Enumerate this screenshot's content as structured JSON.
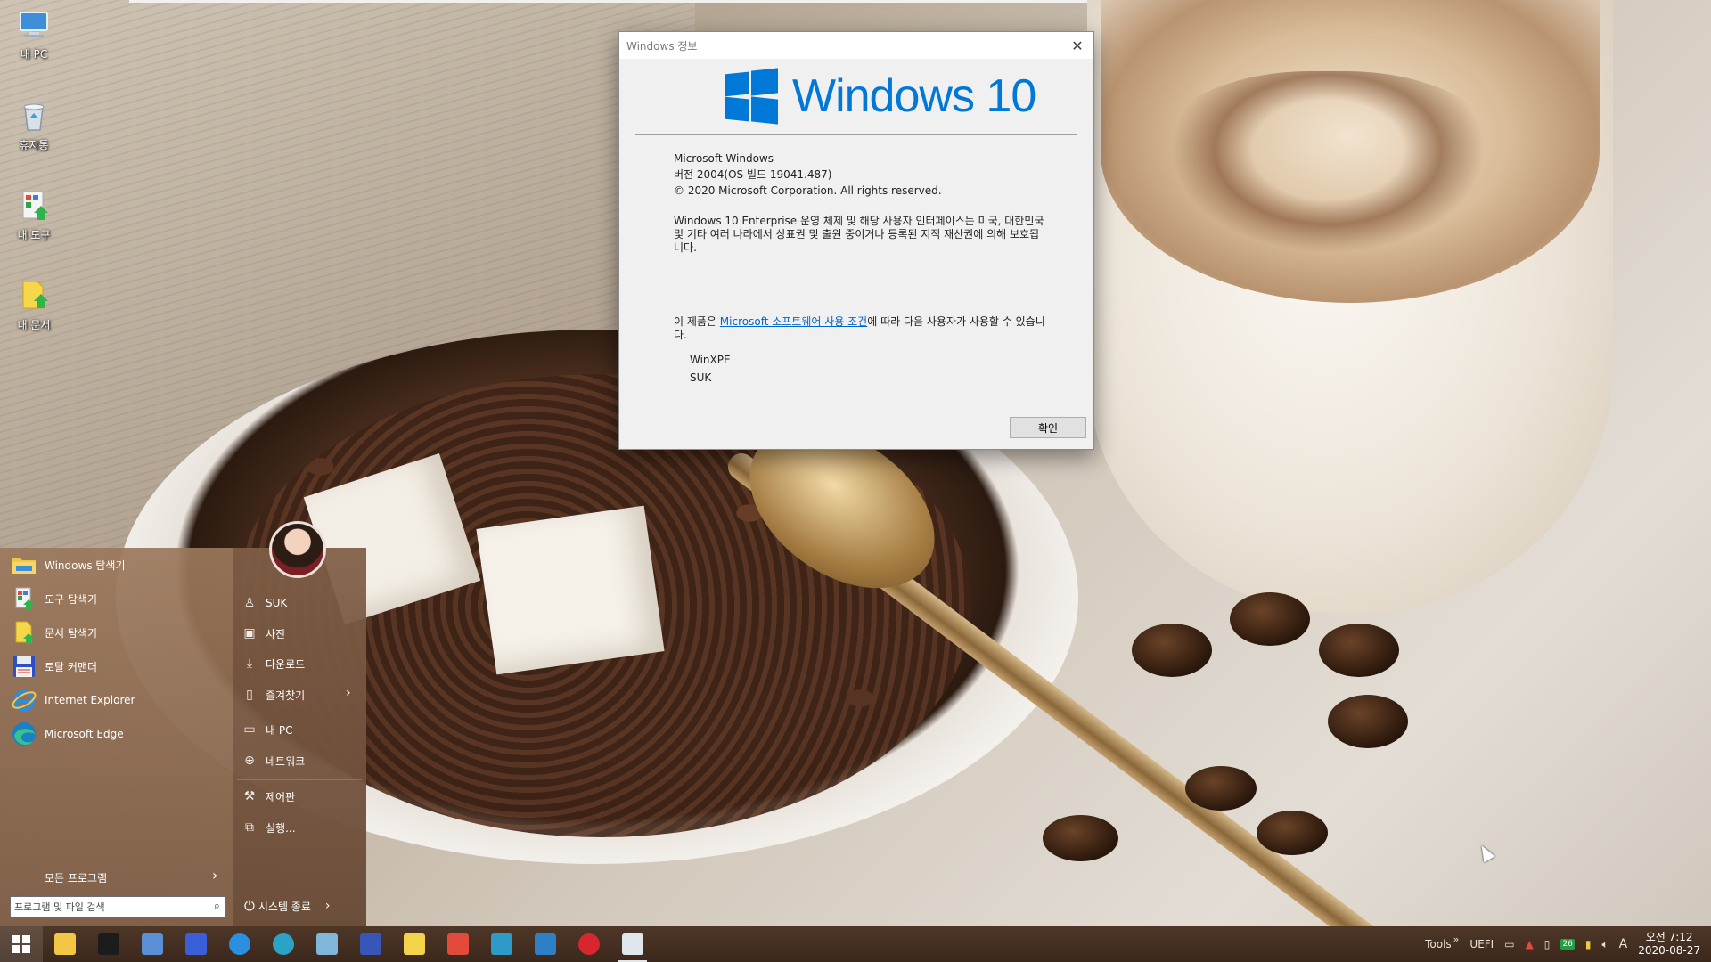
{
  "desktop": {
    "icons": [
      {
        "label": "내 PC",
        "icon": "computer-icon"
      },
      {
        "label": "휴지통",
        "icon": "recycle-bin-icon"
      },
      {
        "label": "내 도구",
        "icon": "tools-shortcut-icon"
      },
      {
        "label": "내 문서",
        "icon": "documents-shortcut-icon"
      }
    ]
  },
  "dialog": {
    "title": "Windows 정보",
    "brand": "Windows 10",
    "product": "Microsoft Windows",
    "version": "버전 2004(OS 빌드 19041.487)",
    "copyright": "© 2020 Microsoft Corporation. All rights reserved.",
    "legal": "Windows 10 Enterprise 운영 체제 및 해당 사용자 인터페이스는 미국, 대한민국 및 기타 여러 나라에서 상표권 및 출원 중이거나 등록된 지적 재산권에 의해 보호됩니다.",
    "license_prefix": "이 제품은 ",
    "license_link": "Microsoft 소프트웨어 사용 조건",
    "license_suffix": "에 따라 다음 사용자가 사용할 수 있습니다.",
    "users": [
      "WinXPE",
      "SUK"
    ],
    "ok_label": "확인"
  },
  "start_menu": {
    "programs": [
      {
        "label": "Windows 탐색기",
        "icon": "folder-icon"
      },
      {
        "label": "도구 탐색기",
        "icon": "tools-icon"
      },
      {
        "label": "문서 탐색기",
        "icon": "document-icon"
      },
      {
        "label": "토탈 커맨더",
        "icon": "floppy-disk-icon"
      },
      {
        "label": "Internet Explorer",
        "icon": "internet-explorer-icon"
      },
      {
        "label": "Microsoft Edge",
        "icon": "edge-icon"
      }
    ],
    "all_programs": "모든 프로그램",
    "search_placeholder": "프로그램 및 파일 검색",
    "right_items": [
      {
        "label": "SUK",
        "icon": "user-icon"
      },
      {
        "label": "사진",
        "icon": "pictures-icon"
      },
      {
        "label": "다운로드",
        "icon": "download-icon"
      },
      {
        "label": "즐겨찾기",
        "icon": "favorites-icon"
      },
      {
        "label": "내 PC",
        "icon": "computer-icon"
      },
      {
        "label": "네트워크",
        "icon": "network-icon"
      },
      {
        "label": "제어판",
        "icon": "control-panel-icon"
      },
      {
        "label": "실행...",
        "icon": "run-icon"
      }
    ],
    "shutdown": "시스템 종료"
  },
  "taskbar": {
    "apps": [
      {
        "name": "file-explorer-icon",
        "color": "#f3c643"
      },
      {
        "name": "command-prompt-icon",
        "color": "#1c1c1c"
      },
      {
        "name": "remote-desktop-icon",
        "color": "#5a8fd6"
      },
      {
        "name": "total-commander-icon",
        "color": "#3b5fd9"
      },
      {
        "name": "internet-explorer-icon",
        "color": "#2b8fe0"
      },
      {
        "name": "edge-icon",
        "color": "#2aa3c6"
      },
      {
        "name": "notepad-icon",
        "color": "#7fb6d9"
      },
      {
        "name": "qr-tool-icon",
        "color": "#3856b8"
      },
      {
        "name": "documents-icon",
        "color": "#f2d34a"
      },
      {
        "name": "tools-icon",
        "color": "#e24b3c"
      },
      {
        "name": "network-tool-icon",
        "color": "#2f9ac7"
      },
      {
        "name": "folder-share-icon",
        "color": "#2f7fc7"
      },
      {
        "name": "power-icon",
        "color": "#d8262e"
      },
      {
        "name": "window-app-icon",
        "color": "#dfe6ee"
      }
    ],
    "tray": {
      "tools": "Tools",
      "chevron": "»",
      "uefi": "UEFI",
      "badge": "26",
      "ime": "A",
      "time": "오전 7:12",
      "date": "2020-08-27"
    }
  }
}
